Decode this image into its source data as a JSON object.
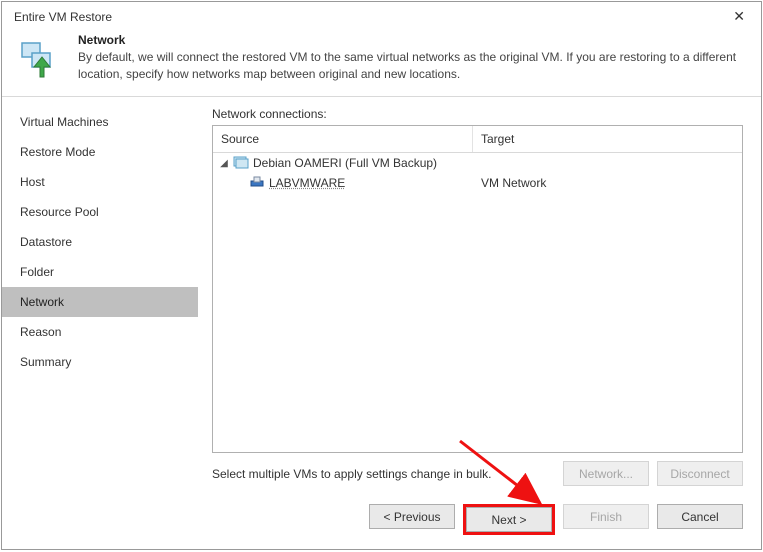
{
  "window": {
    "title": "Entire VM Restore"
  },
  "header": {
    "title": "Network",
    "description": "By default, we will connect the restored VM to the same virtual networks as the original VM. If you are restoring to a different location, specify how networks map between original and new locations."
  },
  "sidebar": {
    "items": [
      {
        "label": "Virtual Machines",
        "selected": false
      },
      {
        "label": "Restore Mode",
        "selected": false
      },
      {
        "label": "Host",
        "selected": false
      },
      {
        "label": "Resource Pool",
        "selected": false
      },
      {
        "label": "Datastore",
        "selected": false
      },
      {
        "label": "Folder",
        "selected": false
      },
      {
        "label": "Network",
        "selected": true
      },
      {
        "label": "Reason",
        "selected": false
      },
      {
        "label": "Summary",
        "selected": false
      }
    ]
  },
  "main": {
    "section_label": "Network connections:",
    "columns": {
      "source": "Source",
      "target": "Target"
    },
    "rows": [
      {
        "type": "vm",
        "source": "Debian OAMERI (Full VM Backup)",
        "target": ""
      },
      {
        "type": "nic",
        "source": "LABVMWARE",
        "target": "VM Network"
      }
    ],
    "bulk_hint": "Select multiple VMs to apply settings change in bulk.",
    "actions": {
      "network_label": "Network...",
      "disconnect_label": "Disconnect"
    }
  },
  "footer": {
    "previous_label": "< Previous",
    "next_label": "Next >",
    "finish_label": "Finish",
    "cancel_label": "Cancel"
  }
}
